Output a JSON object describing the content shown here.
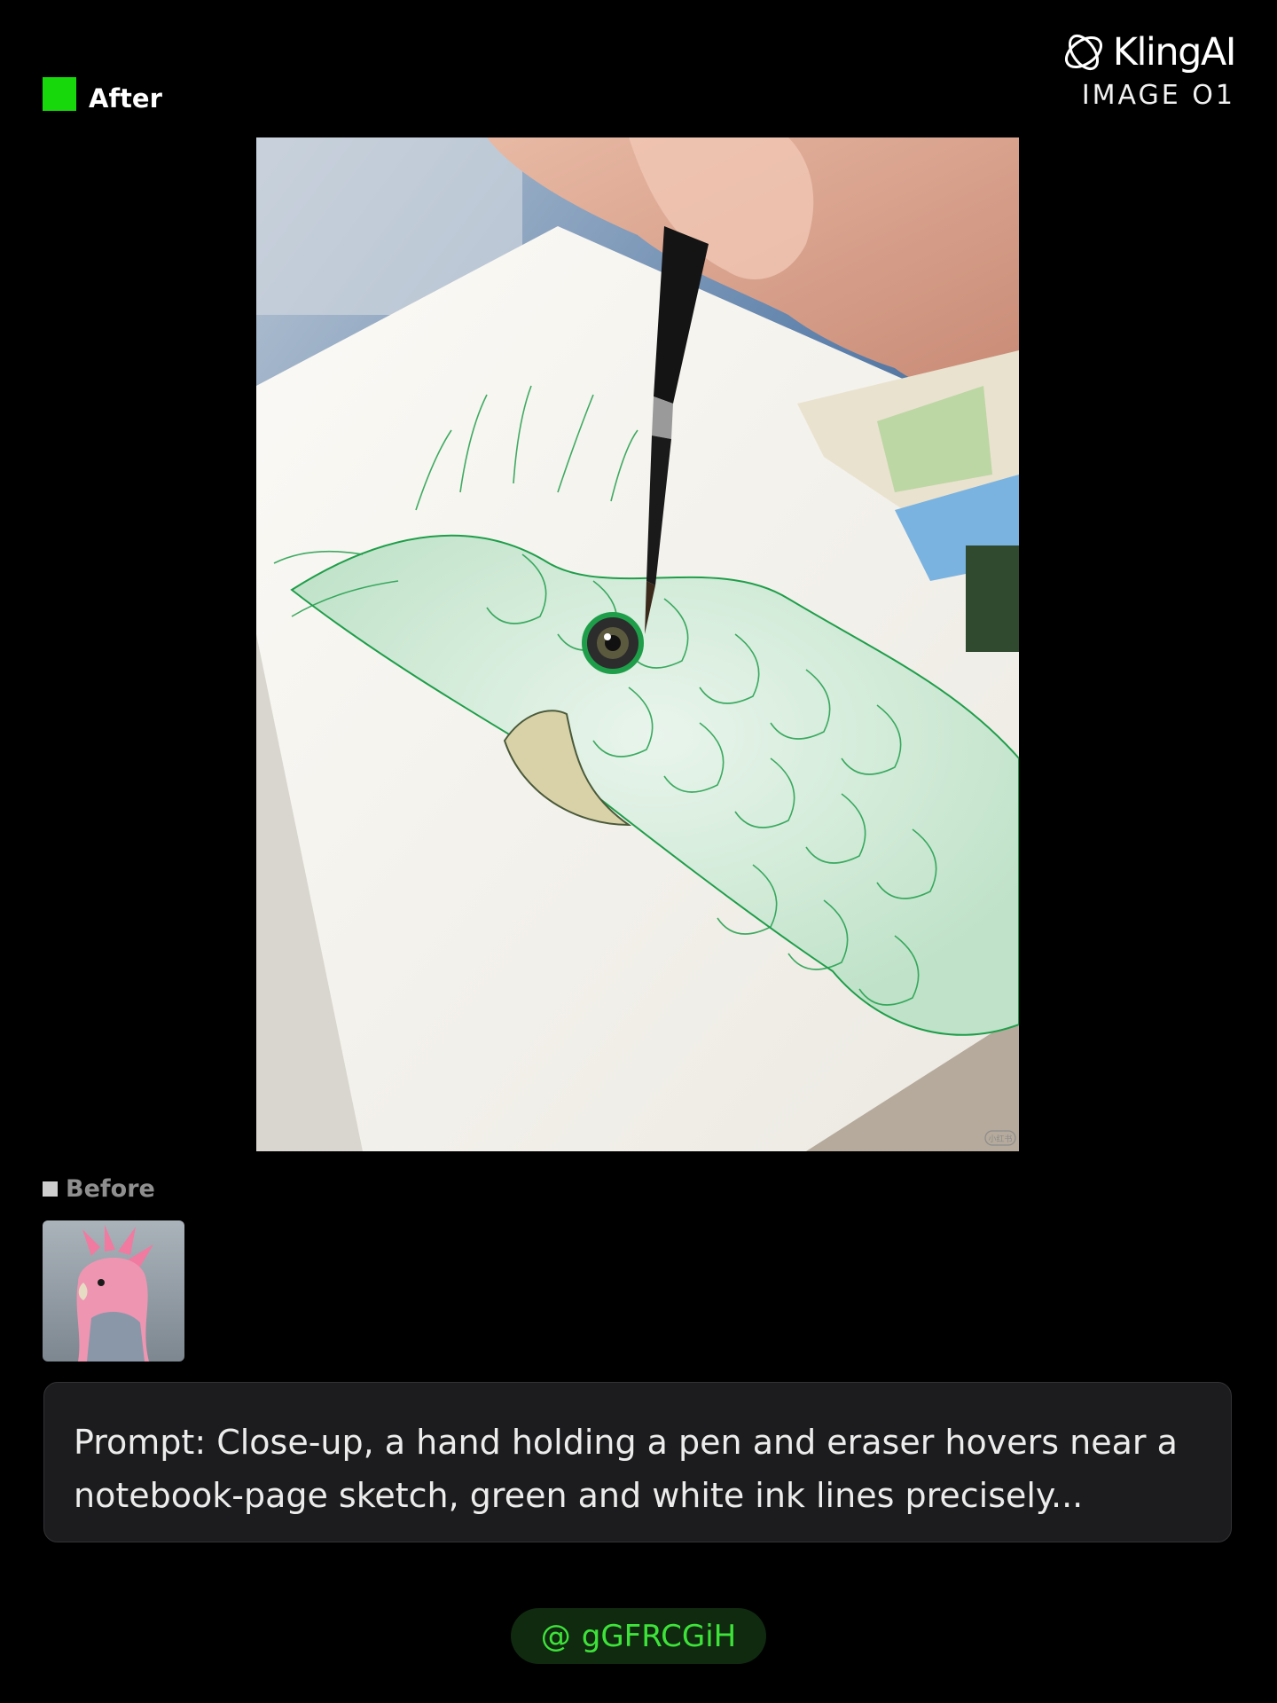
{
  "labels": {
    "after": "After",
    "before": "Before"
  },
  "brand": {
    "name": "KlingAI",
    "product": "IMAGE O1",
    "logo_icon": "kling-loop-logo-icon"
  },
  "main_image": {
    "description_icon": "pen-sketch-green-parrot-image",
    "watermark": "小红书"
  },
  "before_thumbnail": {
    "icon": "pink-cockatoo-thumbnail"
  },
  "prompt": {
    "text": "Prompt: Close-up, a hand holding a pen and eraser hovers near a notebook-page sketch, green and white ink lines precisely..."
  },
  "author": {
    "at": "@",
    "handle": "gGFRCGiH"
  },
  "colors": {
    "background": "#000000",
    "after_marker": "#16d80a",
    "before_marker": "#cfcfcf",
    "prompt_bg": "#1c1c1e",
    "handle_bg": "#102a10",
    "handle_text": "#3ee33a",
    "sketch_ink": "#1f9e4a"
  }
}
